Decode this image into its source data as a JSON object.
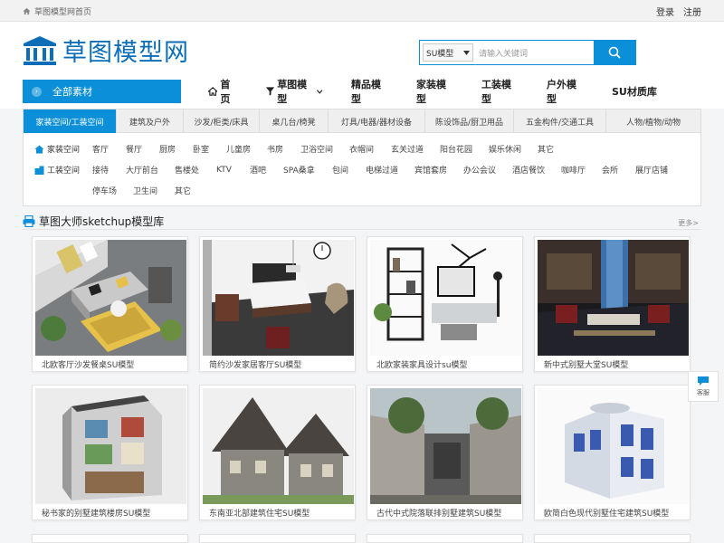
{
  "topbar": {
    "breadcrumb": "草图模型网首页",
    "login": "登录",
    "register": "注册"
  },
  "logo": {
    "text": "草图模型网"
  },
  "search": {
    "type": "SU模型",
    "placeholder": "请输入关键词"
  },
  "category_button": "全部素材",
  "nav": [
    "首页",
    "草图模型",
    "精品模型",
    "家装模型",
    "工装模型",
    "户外模型",
    "SU材质库"
  ],
  "category_tabs": [
    "家装空间/工装空间",
    "建筑及户外",
    "沙发/柜类/床具",
    "桌几台/椅凳",
    "灯具/电器/器材设备",
    "陈设饰品/厨卫用品",
    "五金构件/交通工具",
    "人物/植物/动物"
  ],
  "home_space": {
    "label": "家装空间",
    "items": [
      "客厅",
      "餐厅",
      "厨房",
      "卧室",
      "儿童房",
      "书房",
      "卫浴空间",
      "衣帽间",
      "玄关过道",
      "阳台花园",
      "娱乐休闲",
      "其它"
    ]
  },
  "work_space": {
    "label": "工装空间",
    "items_row1": [
      "接待",
      "大厅前台",
      "售楼处",
      "KTV",
      "酒吧",
      "SPA桑拿",
      "包间",
      "电梯过道",
      "宾馆套房",
      "办公会议",
      "酒店餐饮",
      "咖啡厅",
      "会所",
      "展厅店铺"
    ],
    "items_row2": [
      "停车场",
      "卫生间",
      "其它"
    ]
  },
  "section": {
    "title": "草图大师sketchup模型库",
    "more": "更多>"
  },
  "cards": [
    {
      "caption": "北欧客厅沙发餐桌SU模型"
    },
    {
      "caption": "简约沙发家居客厅SU模型"
    },
    {
      "caption": "北欧家装家具设计su模型"
    },
    {
      "caption": "新中式别墅大堂SU模型"
    },
    {
      "caption": "秘书家的别墅建筑楼房SU模型"
    },
    {
      "caption": "东南亚北部建筑住宅SU模型"
    },
    {
      "caption": "古代中式院落联排别墅建筑SU模型"
    },
    {
      "caption": "欧简白色现代别墅住宅建筑SU模型"
    }
  ],
  "side_service": "客服",
  "colors": {
    "accent": "#0a8fd8",
    "logo": "#0d6eb8"
  }
}
